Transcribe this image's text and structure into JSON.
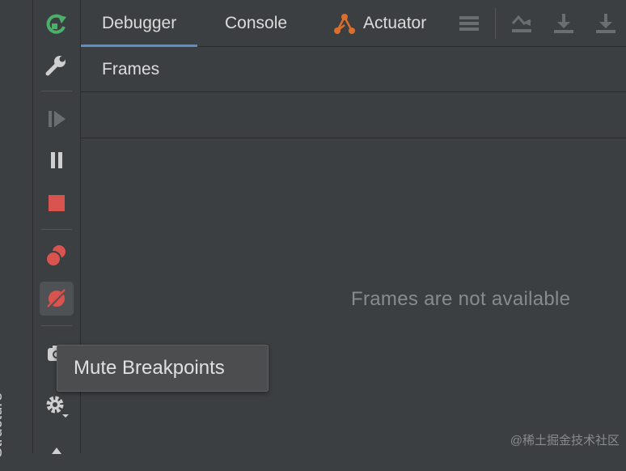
{
  "side_strip": {
    "label": "Structure"
  },
  "tabs": [
    {
      "label": "Debugger"
    },
    {
      "label": "Console"
    },
    {
      "label": "Actuator"
    }
  ],
  "frames": {
    "title": "Frames",
    "empty_message": "Frames are not available"
  },
  "tooltip": {
    "text": "Mute Breakpoints"
  },
  "watermark": {
    "text": "@稀土掘金技术社区"
  },
  "colors": {
    "rerun": "#4caf6a",
    "stop": "#d9534f",
    "breakpoint": "#d9534f",
    "actuator": "#d86f2e",
    "tab_underline": "#5b8fc9"
  },
  "toolbar_icons": [
    "rerun-icon",
    "settings-wrench-icon",
    "resume-icon",
    "pause-icon",
    "stop-icon",
    "view-breakpoints-icon",
    "mute-breakpoints-icon",
    "camera-icon",
    "gear-icon",
    "pin-icon"
  ]
}
